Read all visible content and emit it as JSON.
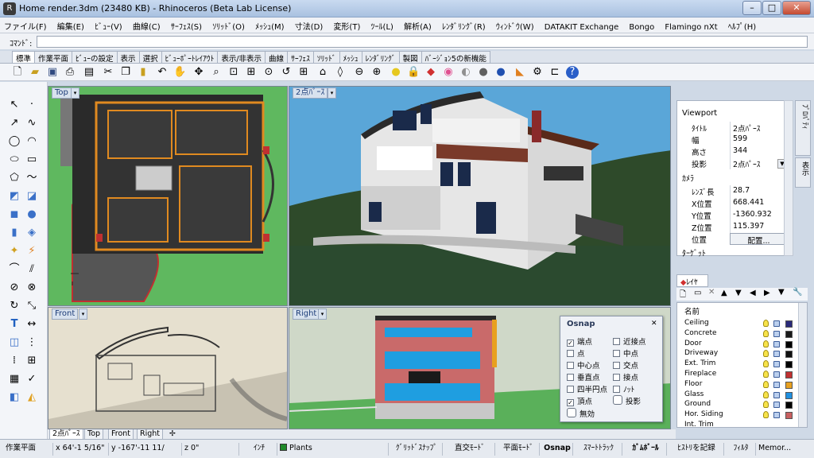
{
  "window": {
    "title": "Home render.3dm (23480 KB) - Rhinoceros (Beta Lab License)",
    "minimize": "–",
    "maximize": "□",
    "close": "✕"
  },
  "menu": [
    "ファイル(F)",
    "編集(E)",
    "ﾋﾞｭｰ(V)",
    "曲線(C)",
    "ｻｰﾌｪｽ(S)",
    "ｿﾘｯﾄﾞ(O)",
    "ﾒｯｼｭ(M)",
    "寸法(D)",
    "変形(T)",
    "ﾂｰﾙ(L)",
    "解析(A)",
    "ﾚﾝﾀﾞﾘﾝｸﾞ(R)",
    "ｳｨﾝﾄﾞｳ(W)",
    "DATAKIT Exchange",
    "Bongo",
    "Flamingo nXt",
    "ﾍﾙﾌﾟ(H)"
  ],
  "command": {
    "label": "ｺﾏﾝﾄﾞ:",
    "value": ""
  },
  "toolbar_tabs": [
    "標準",
    "作業平面",
    "ﾋﾞｭｰの設定",
    "表示",
    "選択",
    "ﾋﾞｭｰﾎﾟｰﾄﾚｲｱｳﾄ",
    "表示/非表示",
    "曲線",
    "ｻｰﾌｪｽ",
    "ｿﾘｯﾄﾞ",
    "ﾒｯｼｭ",
    "ﾚﾝﾀﾞﾘﾝｸﾞ",
    "製図",
    "ﾊﾞｰｼﾞｮﾝ5の新機能"
  ],
  "viewports": {
    "top": "Top",
    "perspective": "2点ﾊﾟｰｽ",
    "front": "Front",
    "right": "Right"
  },
  "viewport_tabs": [
    "2点ﾊﾟｰｽ",
    "Top",
    "Front",
    "Right"
  ],
  "viewport_tab_add": "✢",
  "properties": {
    "side_tabs": [
      "ﾌﾟﾛﾊﾟﾃｨ",
      "表示"
    ],
    "section": "Viewport",
    "rows": [
      {
        "k": "ﾀｲﾄﾙ",
        "v": "2点ﾊﾟｰｽ"
      },
      {
        "k": "幅",
        "v": "599"
      },
      {
        "k": "高さ",
        "v": "344"
      },
      {
        "k": "投影",
        "v": "2点ﾊﾟｰｽ"
      }
    ],
    "camera_section": "ｶﾒﾗ",
    "camera_rows": [
      {
        "k": "ﾚﾝｽﾞ長",
        "v": "28.7"
      },
      {
        "k": "X位置",
        "v": "668.441"
      },
      {
        "k": "Y位置",
        "v": "-1360.932"
      },
      {
        "k": "Z位置",
        "v": "115.397"
      },
      {
        "k": "位置",
        "v": "配置..."
      }
    ],
    "target_section": "ﾀｰｹﾞｯﾄ"
  },
  "layers": {
    "tab": "ﾚｲﾔ",
    "header": "名前",
    "items": [
      {
        "name": "Ceiling",
        "color": "#2a2a7a"
      },
      {
        "name": "Concrete",
        "color": "#1a1a1a"
      },
      {
        "name": "Door",
        "color": "#000000"
      },
      {
        "name": "Driveway",
        "color": "#111111"
      },
      {
        "name": "Ext. Trim",
        "color": "#000000"
      },
      {
        "name": "Fireplace",
        "color": "#c03030"
      },
      {
        "name": "Floor",
        "color": "#e8a020"
      },
      {
        "name": "Glass",
        "color": "#2090e0"
      },
      {
        "name": "Ground",
        "color": "#000000"
      },
      {
        "name": "Hor. Siding",
        "color": "#c86060"
      },
      {
        "name": "Int. Trim",
        "color": "#555555"
      }
    ]
  },
  "osnap": {
    "title": "Osnap",
    "items": [
      {
        "label": "端点",
        "checked": true
      },
      {
        "label": "近接点",
        "checked": false
      },
      {
        "label": "点",
        "checked": false
      },
      {
        "label": "中点",
        "checked": false
      },
      {
        "label": "中心点",
        "checked": false
      },
      {
        "label": "交点",
        "checked": false
      },
      {
        "label": "垂直点",
        "checked": false
      },
      {
        "label": "接点",
        "checked": false
      },
      {
        "label": "四半円点",
        "checked": false
      },
      {
        "label": "ﾉｯﾄ",
        "checked": false
      },
      {
        "label": "頂点",
        "checked": true
      },
      {
        "label": "投影",
        "checked": false
      }
    ],
    "disable": "無効"
  },
  "status": {
    "cplane": "作業平面",
    "x": "x 64'-1 5/16\"",
    "y": "y -167'-11 11/",
    "z": "z 0\"",
    "units": "ｲﾝﾁ",
    "layer": "Plants",
    "grid_snap": "ｸﾞﾘｯﾄﾞｽﾅｯﾌﾟ",
    "ortho": "直交ﾓｰﾄﾞ",
    "planar": "平面ﾓｰﾄﾞ",
    "osnap": "Osnap",
    "smarttrack": "ｽﾏｰﾄﾄﾗｯｸ",
    "gumball": "ｶﾞﾑﾎﾞｰﾙ",
    "history": "ﾋｽﾄﾘを記録",
    "filter": "ﾌｨﾙﾀ",
    "memory": "Memor..."
  },
  "colors": {
    "top_bg": "#5fb85f",
    "persp_sky": "#5aa6d8",
    "front_bg": "#e6e0cf",
    "right_bg": "#cfd8c8"
  }
}
